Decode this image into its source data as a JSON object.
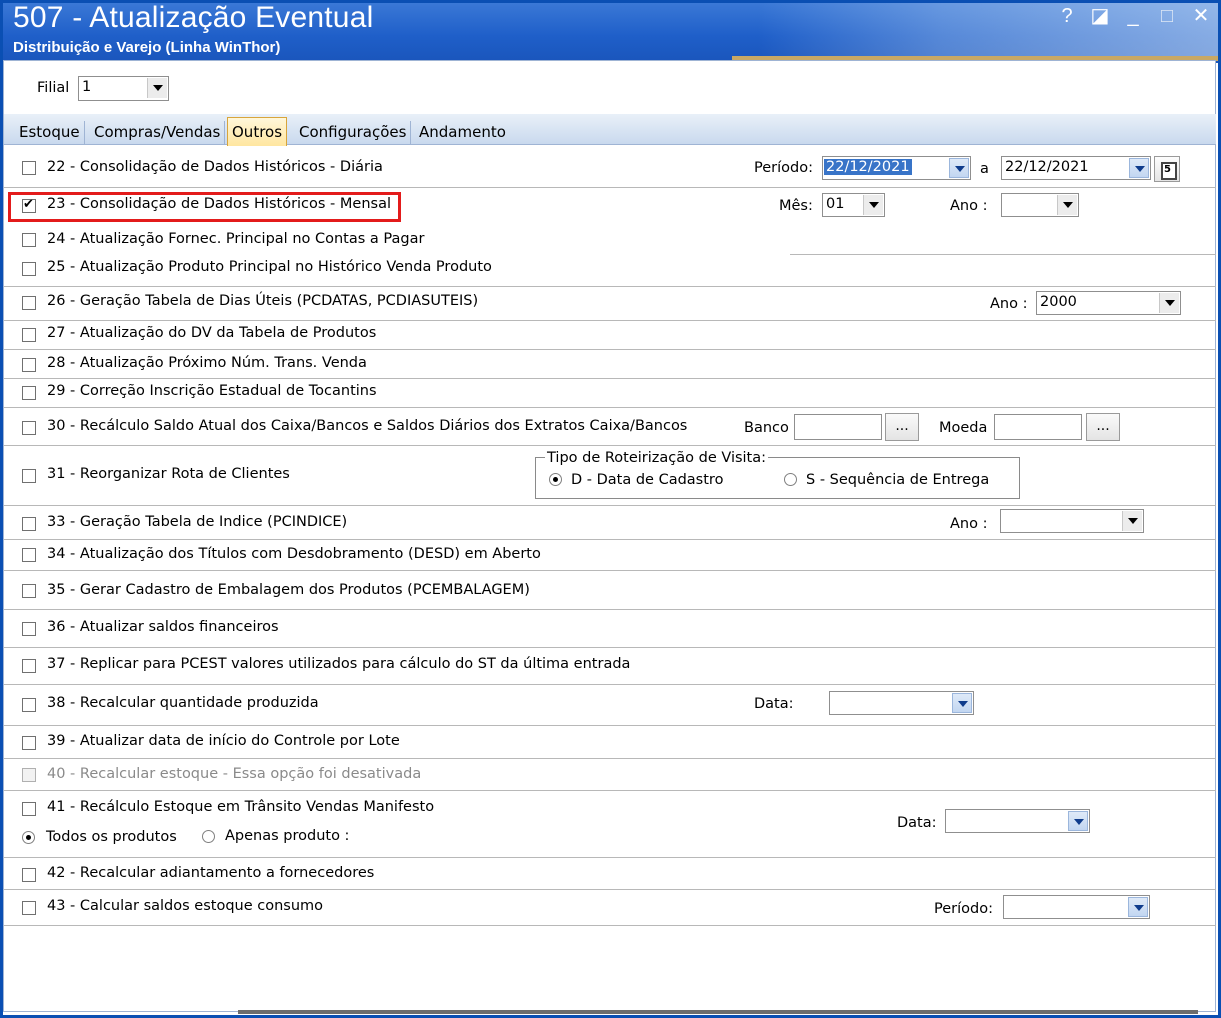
{
  "window": {
    "title": "507 - Atualização Eventual",
    "subtitle": "Distribuição e Varejo (Linha WinThor)",
    "buttons": {
      "help": "?",
      "restore": "◪",
      "minimize": "_",
      "maximize": "□",
      "close": "✕"
    }
  },
  "filial": {
    "label": "Filial",
    "value": "1"
  },
  "tabs": [
    "Estoque",
    "Compras/Vendas",
    "Outros",
    "Configurações",
    "Andamento"
  ],
  "active_tab": "Outros",
  "options": {
    "o22": {
      "label": "22 - Consolidação de Dados Históricos - Diária",
      "checked": false
    },
    "o23": {
      "label": "23 - Consolidação de Dados Históricos - Mensal",
      "checked": true
    },
    "o24": {
      "label": "24 - Atualização Fornec. Principal no Contas a Pagar",
      "checked": false
    },
    "o25": {
      "label": "25 - Atualização Produto Principal no Histórico Venda Produto",
      "checked": false
    },
    "o26": {
      "label": "26 - Geração Tabela de Dias Úteis (PCDATAS, PCDIASUTEIS)",
      "checked": false
    },
    "o27": {
      "label": "27 - Atualização do DV da Tabela de Produtos",
      "checked": false
    },
    "o28": {
      "label": "28 - Atualização Próximo Núm. Trans. Venda",
      "checked": false
    },
    "o29": {
      "label": "29 - Correção Inscrição Estadual de Tocantins",
      "checked": false
    },
    "o30": {
      "label": "30 - Recálculo Saldo Atual dos Caixa/Bancos e Saldos Diários dos Extratos Caixa/Bancos",
      "checked": false
    },
    "o31": {
      "label": "31 - Reorganizar Rota de Clientes",
      "checked": false
    },
    "o33": {
      "label": "33 - Geração Tabela de Indice (PCINDICE)",
      "checked": false
    },
    "o34": {
      "label": "34 - Atualização dos Títulos com Desdobramento (DESD) em Aberto",
      "checked": false
    },
    "o35": {
      "label": "35 - Gerar Cadastro de Embalagem dos Produtos (PCEMBALAGEM)",
      "checked": false
    },
    "o36": {
      "label": "36 - Atualizar saldos financeiros",
      "checked": false
    },
    "o37": {
      "label": "37 - Replicar para PCEST valores utilizados para cálculo do ST da última entrada",
      "checked": false
    },
    "o38": {
      "label": "38 - Recalcular quantidade produzida",
      "checked": false
    },
    "o39": {
      "label": "39 - Atualizar data de início do Controle por Lote",
      "checked": false
    },
    "o40": {
      "label": "40 - Recalcular estoque - Essa opção foi desativada",
      "checked": false,
      "disabled": true
    },
    "o41": {
      "label": "41 - Recálculo Estoque em Trânsito Vendas Manifesto",
      "checked": false
    },
    "o42": {
      "label": "42 - Recalcular adiantamento a fornecedores",
      "checked": false
    },
    "o43": {
      "label": "43 - Calcular saldos estoque consumo",
      "checked": false
    }
  },
  "fields": {
    "periodo_label": "Período:",
    "periodo_from": "22/12/2021",
    "periodo_sep": "a",
    "periodo_to": "22/12/2021",
    "mes_label": "Mês:",
    "mes_value": "01",
    "ano23_label": "Ano :",
    "ano23_value": "",
    "ano26_label": "Ano :",
    "ano26_value": "2000",
    "banco_label": "Banco",
    "banco_value": "",
    "moeda_label": "Moeda",
    "moeda_value": "",
    "browse": "...",
    "roteirizacao_title": "Tipo de Roteirização de Visita:",
    "roteirizacao_options": [
      "D - Data de Cadastro",
      "S - Sequência de Entrega"
    ],
    "roteirizacao_selected": "D - Data de Cadastro",
    "ano33_label": "Ano :",
    "ano33_value": "",
    "data38_label": "Data:",
    "data38_value": "",
    "produtos_options": [
      "Todos os produtos",
      "Apenas produto :"
    ],
    "produtos_selected": "Todos os produtos",
    "data41_label": "Data:",
    "data41_value": "",
    "periodo43_label": "Período:",
    "periodo43_value": ""
  },
  "colors": {
    "titlebar": "#1f5fc9",
    "tabbar": "#c9d9ee",
    "active_tab": "#ffe6a0",
    "highlight": "#e31b1b",
    "selection": "#3874c8"
  }
}
